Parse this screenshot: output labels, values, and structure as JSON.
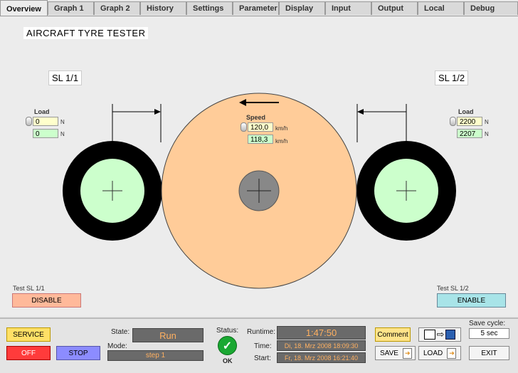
{
  "tabs": [
    "Overview",
    "Graph 1",
    "Graph 2",
    "History",
    "Settings",
    "Parameter",
    "Display",
    "Input",
    "Output",
    "Local",
    "Debug"
  ],
  "title": "AIRCRAFT TYRE TESTER",
  "sl_left": {
    "label": "SL 1/1",
    "load_label": "Load",
    "load_set": "0",
    "load_actual": "0",
    "unit": "N",
    "test_label": "Test SL 1/1",
    "button": "DISABLE"
  },
  "sl_right": {
    "label": "SL 1/2",
    "load_label": "Load",
    "load_set": "2200",
    "load_actual": "2207",
    "unit": "N",
    "test_label": "Test SL 1/2",
    "button": "ENABLE"
  },
  "speed": {
    "label": "Speed",
    "set": "120,0",
    "actual": "118,3",
    "unit": "km/h"
  },
  "bottom": {
    "service": "SERVICE",
    "off": "OFF",
    "stop": "STOP",
    "state_label": "State:",
    "state_value": "Run",
    "mode_label": "Mode:",
    "mode_value": "step 1",
    "status_label": "Status:",
    "status_value": "OK",
    "runtime_label": "Runtime:",
    "runtime_value": "1:47:50",
    "time_label": "Time:",
    "time_value": "Di, 18. Mrz 2008 18:09:30",
    "start_label": "Start:",
    "start_value": "Fr, 18. Mrz 2008 16:21:40",
    "comment": "Comment",
    "save": "SAVE",
    "load": "LOAD",
    "save_cycle_label": "Save cycle:",
    "save_cycle_value": "5 sec",
    "exit": "EXIT"
  },
  "colors": {
    "drum": "#ffcc99",
    "tyre_hub": "#ccffcc",
    "disable_btn": "#ffb99a",
    "enable_btn": "#a8e4e8",
    "service_btn": "#ffe066",
    "off_btn": "#ff3b3b",
    "stop_btn": "#8c8cff",
    "comment_btn": "#ffe48a"
  }
}
